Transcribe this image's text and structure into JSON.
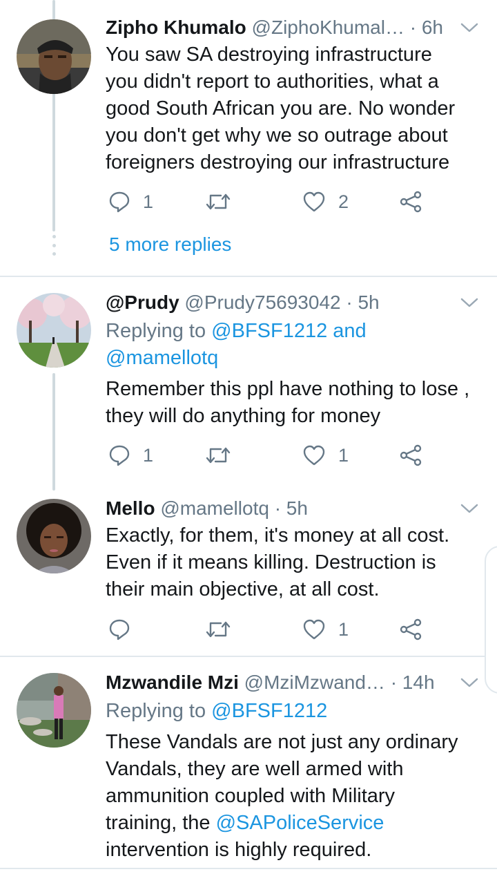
{
  "tweets": [
    {
      "name": "Zipho Khumalo",
      "meta": " @ZiphoKhumal… · 6h",
      "text_lines": [
        "You saw SA destroying infrastructure",
        "you didn't report to authorities, what a",
        "good South African you are. No wonder",
        "you don't get why we so outrage about",
        "foreigners destroying our infrastructure"
      ],
      "reply_count": "1",
      "retweet_count": "",
      "like_count": "2"
    },
    {
      "name": "@Prudy",
      "meta": " @Prudy75693042 · 5h",
      "replying_prefix": "Replying to ",
      "replying_link1": "@BFSF1212 and",
      "replying_link2": "@mamellotq",
      "text_lines": [
        "Remember this ppl have nothing to lose ,",
        "they will do anything for money"
      ],
      "reply_count": "1",
      "retweet_count": "",
      "like_count": "1"
    },
    {
      "name": "Mello",
      "meta": " @mamellotq · 5h",
      "text_lines": [
        "Exactly, for them, it's money at all cost.",
        "Even if it means killing. Destruction is",
        "their main objective, at all cost."
      ],
      "reply_count": "",
      "retweet_count": "",
      "like_count": "1"
    },
    {
      "name": "Mzwandile Mzi",
      "meta": " @MziMzwand… · 14h",
      "replying_prefix": "Replying to ",
      "replying_link1": "@BFSF1212",
      "text_lines": [
        "These Vandals are not just any ordinary",
        "Vandals, they are well armed with",
        "ammunition coupled with Military",
        "intervention is highly required."
      ],
      "text_line4_prefix": "training, the ",
      "text_line4_link": "@SAPoliceService"
    }
  ],
  "more_replies": "5 more replies",
  "icons": {
    "reply": "reply-icon",
    "retweet": "retweet-icon",
    "like": "heart-icon",
    "share": "share-icon",
    "menu": "chevron-down-icon"
  },
  "colors": {
    "link": "#1b95e0",
    "secondary": "#657786",
    "thread_line": "#cfd9de",
    "divider": "#e1e8ed"
  }
}
